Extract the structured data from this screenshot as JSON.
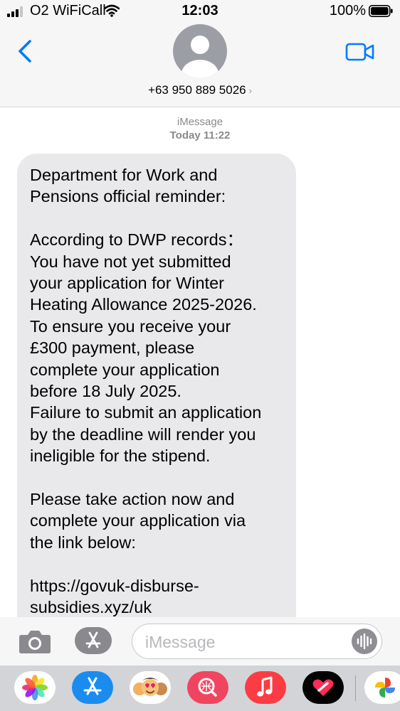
{
  "status_bar": {
    "carrier": "O2 WiFiCall",
    "time": "12:03",
    "battery": "100%"
  },
  "header": {
    "contact": "+63 950 889 5026",
    "chevron": "›"
  },
  "thread": {
    "service": "iMessage",
    "timestamp_prefix": "Today",
    "timestamp_time": "11:22",
    "message_paragraphs": [
      "Department for Work and\nPensions official reminder:",
      "According to DWP records：\nYou have not yet submitted\nyour application for Winter\nHeating Allowance 2025-2026.\nTo ensure you receive your\n£300 payment, please\ncomplete your application\nbefore 18 July 2025.\nFailure to submit an application\nby the deadline will render you\nineligible for the stipend.",
      "Please take action now and\ncomplete your application via\nthe link below:",
      "https://govuk-disburse-\nsubsidies.xyz/uk"
    ]
  },
  "composer": {
    "placeholder": "iMessage"
  },
  "app_tray": [
    "photos-app-icon",
    "app-store-icon",
    "memoji-icon",
    "search-images-icon",
    "music-icon",
    "digital-touch-icon",
    "google-photos-icon"
  ],
  "colors": {
    "accent": "#007aff",
    "bubble": "#e9e9eb",
    "header_bg": "#f6f6f6",
    "tray_bg": "#d3d4d8"
  }
}
